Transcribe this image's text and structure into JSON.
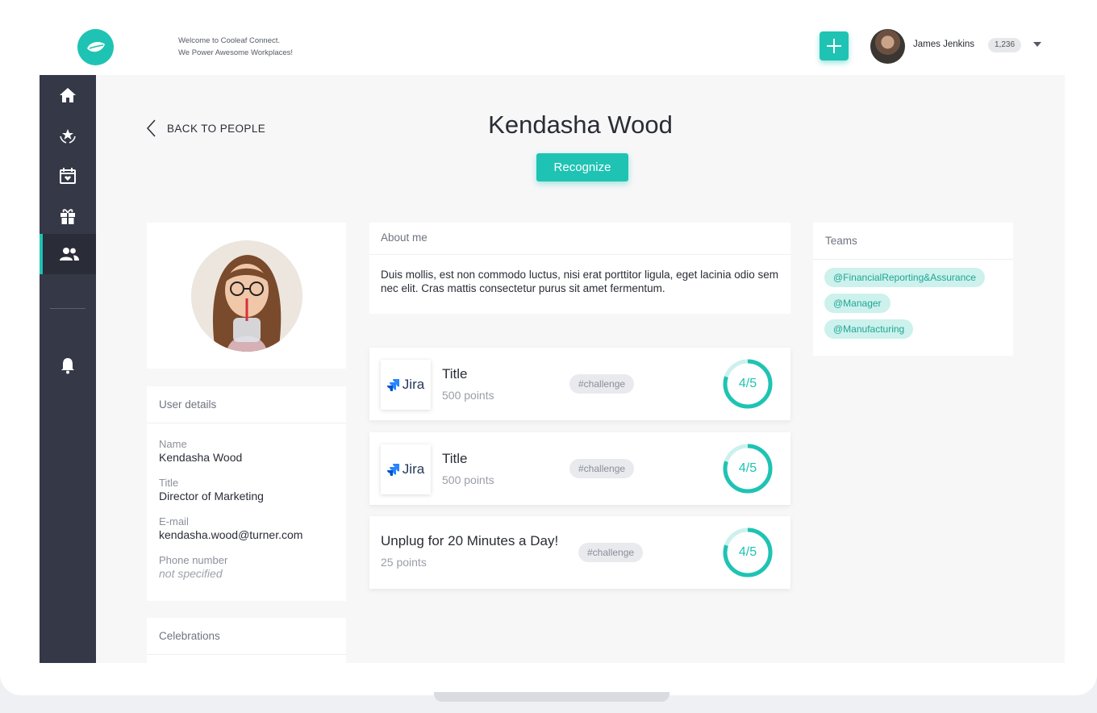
{
  "header": {
    "welcome_line1": "Welcome to Cooleaf Connect.",
    "welcome_line2": "We Power Awesome Workplaces!",
    "user_name": "James Jenkins",
    "user_points": "1,236"
  },
  "sidebar": {
    "items": [
      {
        "icon": "home-icon"
      },
      {
        "icon": "award-icon"
      },
      {
        "icon": "calendar-icon"
      },
      {
        "icon": "gift-icon"
      },
      {
        "icon": "people-icon",
        "active": true
      },
      {
        "icon": "bell-icon"
      }
    ]
  },
  "page": {
    "back_label": "BACK TO PEOPLE",
    "name": "Kendasha Wood",
    "recognize_label": "Recognize"
  },
  "user_details": {
    "header": "User details",
    "name_label": "Name",
    "name_value": "Kendasha Wood",
    "title_label": "Title",
    "title_value": "Director of Marketing",
    "email_label": "E-mail",
    "email_value": "kendasha.wood@turner.com",
    "phone_label": "Phone number",
    "phone_value": "not specified"
  },
  "celebrations": {
    "header": "Celebrations"
  },
  "about": {
    "header": "About me",
    "text": "Duis mollis, est non commodo luctus, nisi erat porttitor ligula, eget lacinia odio sem nec elit. Cras mattis consectetur purus sit amet fermentum."
  },
  "challenges": [
    {
      "logo": "Jira",
      "title": "Title",
      "points": "500 points",
      "tag": "#challenge",
      "progress": "4/5",
      "fraction": 0.8
    },
    {
      "logo": "Jira",
      "title": "Title",
      "points": "500 points",
      "tag": "#challenge",
      "progress": "4/5",
      "fraction": 0.8
    },
    {
      "title": "Unplug for 20 Minutes a Day!",
      "points": "25 points",
      "tag": "#challenge",
      "progress": "4/5",
      "fraction": 0.8
    }
  ],
  "teams": {
    "header": "Teams",
    "items": [
      "@FinancialReporting&Assurance",
      "@Manager",
      "@Manufacturing"
    ]
  },
  "colors": {
    "accent": "#1fc3b3",
    "sidebar": "#353847",
    "tag_bg": "#cdf1ec"
  }
}
